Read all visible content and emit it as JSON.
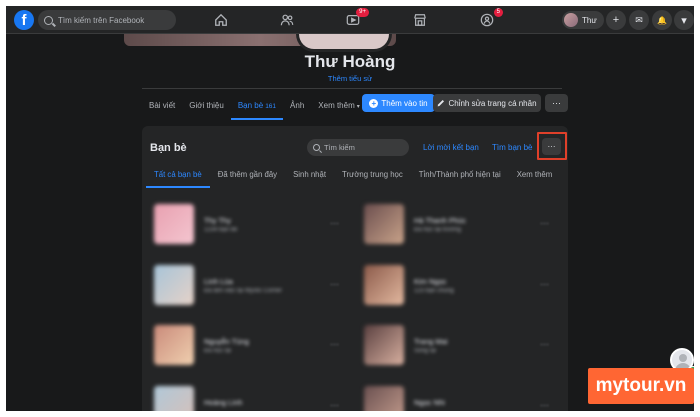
{
  "topbar": {
    "logo": "f",
    "search_placeholder": "Tìm kiếm trên Facebook",
    "nav": [
      {
        "icon": "home-icon"
      },
      {
        "icon": "friends-icon"
      },
      {
        "icon": "watch-icon",
        "badge": "9+"
      },
      {
        "icon": "marketplace-icon"
      },
      {
        "icon": "groups-icon",
        "badge": "5"
      }
    ],
    "profile_label": "Thư",
    "actions": [
      {
        "icon": "plus-icon",
        "glyph": "+"
      },
      {
        "icon": "messenger-icon",
        "glyph": "✉"
      },
      {
        "icon": "bell-icon",
        "glyph": "🔔"
      },
      {
        "icon": "chevron-down-icon",
        "glyph": "▾"
      }
    ]
  },
  "profile": {
    "name": "Thư Hoàng",
    "bio_link": "Thêm tiểu sử",
    "tabs": [
      {
        "label": "Bài viết"
      },
      {
        "label": "Giới thiệu"
      },
      {
        "label": "Bạn bè",
        "count": "161"
      },
      {
        "label": "Ảnh"
      },
      {
        "label": "Xem thêm",
        "caret": "▾"
      }
    ],
    "add_story": "Thêm vào tin",
    "edit_profile": "Chỉnh sửa trang cá nhân",
    "more": "···"
  },
  "friends": {
    "title": "Bạn bè",
    "search_placeholder": "Tìm kiếm",
    "requests_link": "Lời mời kết bạn",
    "find_link": "Tìm bạn bè",
    "more": "···",
    "tabs": [
      {
        "label": "Tất cả bạn bè"
      },
      {
        "label": "Đã thêm gần đây"
      },
      {
        "label": "Sinh nhật"
      },
      {
        "label": "Trường trung học"
      },
      {
        "label": "Tỉnh/Thành phố hiện tại"
      },
      {
        "label": "Xem thêm"
      }
    ],
    "list": [
      {
        "name": "Thy Thy",
        "sub": "1234 bạn bè",
        "color_a": "#e8a0b0",
        "color_b": "#f4c6d0"
      },
      {
        "name": "Hà Thanh Phúc",
        "sub": "Đã học tại trường",
        "color_a": "#6b4e4e",
        "color_b": "#c9a38a"
      },
      {
        "name": "Linh Lúa",
        "sub": "Đã làm việc tại Mystic Corner",
        "color_a": "#a7c4d8",
        "color_b": "#e6d2c8"
      },
      {
        "name": "Kim Ngọc",
        "sub": "123 bạn chung",
        "color_a": "#8b5a4a",
        "color_b": "#e3b9a0"
      },
      {
        "name": "Nguyễn Tùng",
        "sub": "Đã học tại",
        "color_a": "#c98a7a",
        "color_b": "#f0d0b0"
      },
      {
        "name": "Trang Mai",
        "sub": "Sống tại",
        "color_a": "#5a4040",
        "color_b": "#d8b0a0"
      },
      {
        "name": "Hoàng Linh",
        "sub": "",
        "color_a": "#b0c8d8",
        "color_b": "#d8c0b8"
      },
      {
        "name": "Ngọc Nhi",
        "sub": "",
        "color_a": "#6a5050",
        "color_b": "#c8a090"
      }
    ]
  },
  "watermark": "mytour.vn"
}
